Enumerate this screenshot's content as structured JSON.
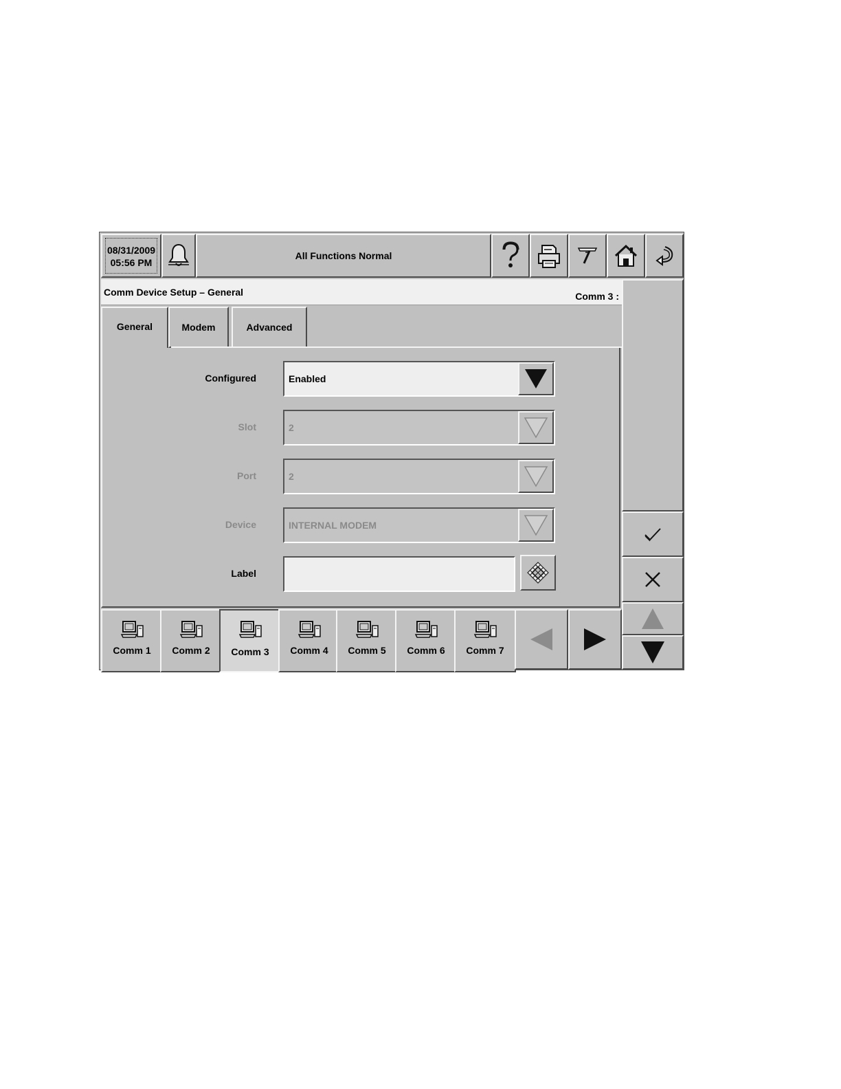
{
  "header": {
    "date": "08/31/2009",
    "time": "05:56 PM",
    "status": "All Functions Normal"
  },
  "title_bar": {
    "title": "Comm Device Setup – General",
    "context": "Comm 3 :"
  },
  "tabs": [
    {
      "label": "General",
      "active": true
    },
    {
      "label": "Modem",
      "active": false
    },
    {
      "label": "Advanced",
      "active": false
    }
  ],
  "form": {
    "configured": {
      "label": "Configured",
      "value": "Enabled"
    },
    "slot": {
      "label": "Slot",
      "value": "2"
    },
    "port": {
      "label": "Port",
      "value": "2"
    },
    "device": {
      "label": "Device",
      "value": "INTERNAL MODEM"
    },
    "label": {
      "label": "Label",
      "value": ""
    }
  },
  "comm_buttons": [
    {
      "label": "Comm 1",
      "selected": false
    },
    {
      "label": "Comm 2",
      "selected": false
    },
    {
      "label": "Comm 3",
      "selected": true
    },
    {
      "label": "Comm 4",
      "selected": false
    },
    {
      "label": "Comm 5",
      "selected": false
    },
    {
      "label": "Comm 6",
      "selected": false
    },
    {
      "label": "Comm 7",
      "selected": false
    }
  ],
  "icons": {
    "alarm": "bell-icon",
    "help": "question-icon",
    "print": "printer-icon",
    "diag": "tool-icon",
    "home": "home-icon",
    "back": "return-arrow-icon",
    "accept": "checkmark-icon",
    "cancel": "x-icon",
    "keyboard": "keyboard-icon"
  },
  "colors": {
    "panel": "#c0c0c0",
    "field_enabled": "#eeeeee",
    "text_disabled": "#8a8a8a"
  }
}
